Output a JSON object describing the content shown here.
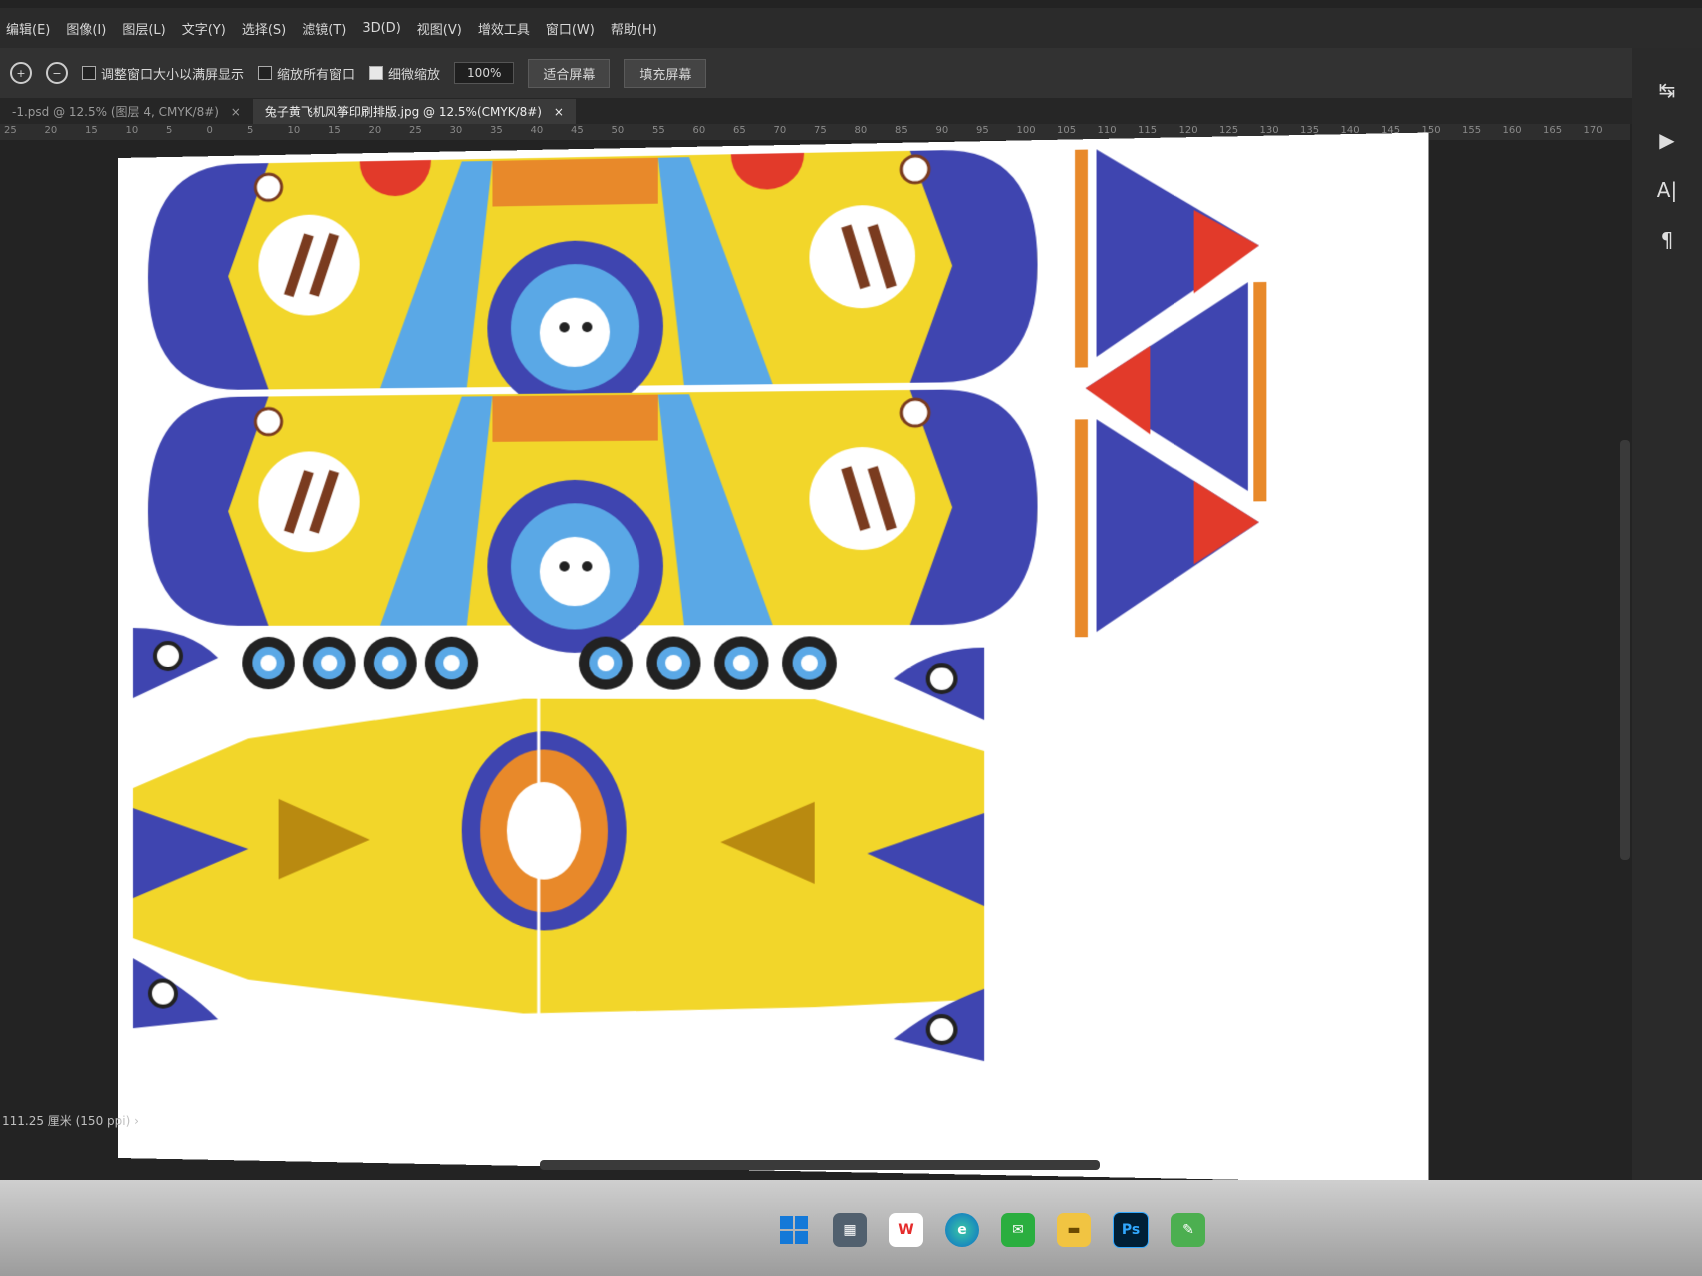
{
  "menu": [
    "编辑(E)",
    "图像(I)",
    "图层(L)",
    "文字(Y)",
    "选择(S)",
    "滤镜(T)",
    "3D(D)",
    "视图(V)",
    "增效工具",
    "窗口(W)",
    "帮助(H)"
  ],
  "options": {
    "resize_windows": "调整窗口大小以满屏显示",
    "zoom_all": "缩放所有窗口",
    "scrubby_zoom": "细微缩放",
    "zoom_value": "100%",
    "fit_screen": "适合屏幕",
    "fill_screen": "填充屏幕"
  },
  "tabs": [
    {
      "label": "-1.psd @ 12.5% (图层 4, CMYK/8#)",
      "close": "×"
    },
    {
      "label": "兔子黄飞机风筝印刷排版.jpg @ 12.5%(CMYK/8#)",
      "close": "×"
    }
  ],
  "ruler_ticks": [
    "25",
    "20",
    "15",
    "10",
    "5",
    "0",
    "5",
    "10",
    "15",
    "20",
    "25",
    "30",
    "35",
    "40",
    "45",
    "50",
    "55",
    "60",
    "65",
    "70",
    "75",
    "80",
    "85",
    "90",
    "95",
    "100",
    "105",
    "110",
    "115",
    "120",
    "125",
    "130",
    "135",
    "140",
    "145",
    "150",
    "155",
    "160",
    "165",
    "170"
  ],
  "status_bar": "111.25 厘米 (150 ppi)",
  "status_arrow": "›",
  "right_panel": [
    "↹",
    "▶",
    "A|",
    "¶"
  ],
  "panel_collapse": "«",
  "taskbar": {
    "calculator": "▦",
    "wps": "W",
    "edge": "e",
    "wechat": "✉",
    "files": "▬",
    "photoshop": "Ps",
    "notes": "✎"
  },
  "colors": {
    "yellow": "#f2d62a",
    "blue": "#3f45b0",
    "light_blue": "#5aa8e6",
    "orange": "#e8892a",
    "red": "#e23a2a",
    "brown": "#7a3b1f"
  }
}
